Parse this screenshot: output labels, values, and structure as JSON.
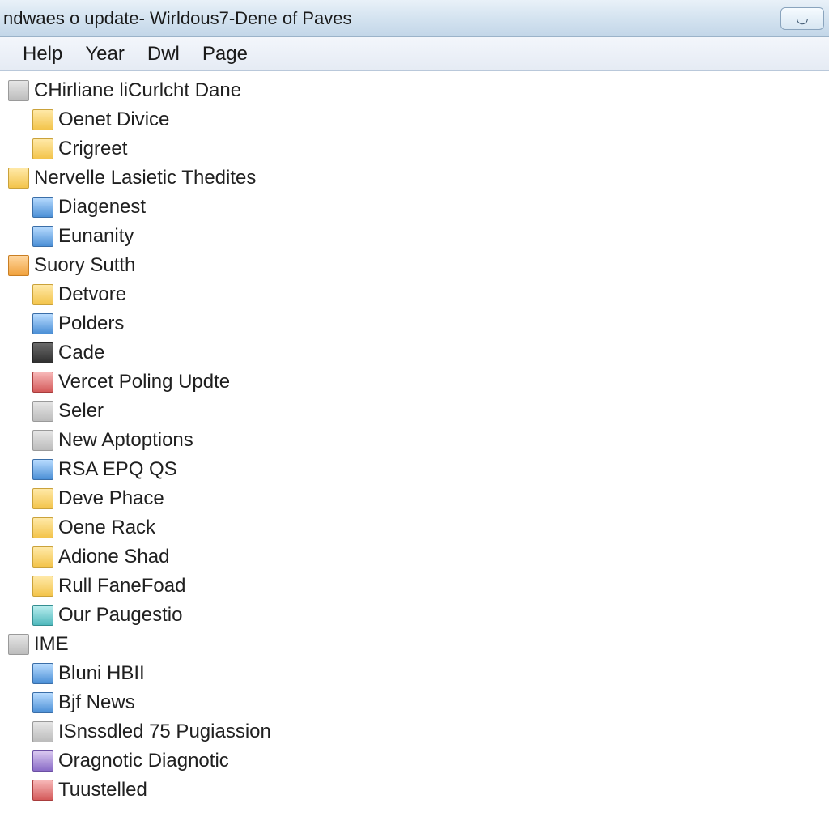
{
  "window": {
    "title": "ndwaes o update- Wirldous7-Dene of Paves",
    "minimize_glyph": "◡"
  },
  "menu": {
    "items": [
      "Help",
      "Year",
      "Dwl",
      "Page"
    ]
  },
  "list": {
    "items": [
      {
        "label": "CHirliane liCurlcht Dane",
        "icon": "ic-gray",
        "indent": false
      },
      {
        "label": "Oenet Divice",
        "icon": "ic-folder",
        "indent": true
      },
      {
        "label": "Crigreet",
        "icon": "ic-folder",
        "indent": true
      },
      {
        "label": "Nervelle Lasietic Thedites",
        "icon": "ic-folder",
        "indent": false
      },
      {
        "label": "Diagenest",
        "icon": "ic-blue",
        "indent": true
      },
      {
        "label": "Eunanity",
        "icon": "ic-blue",
        "indent": true
      },
      {
        "label": "Suory Sutth",
        "icon": "ic-orange",
        "indent": false
      },
      {
        "label": "Detvore",
        "icon": "ic-folder",
        "indent": true
      },
      {
        "label": "Polders",
        "icon": "ic-blue",
        "indent": true
      },
      {
        "label": "Cade",
        "icon": "ic-dark",
        "indent": true
      },
      {
        "label": "Vercet Poling Updte",
        "icon": "ic-red",
        "indent": true
      },
      {
        "label": "Seler",
        "icon": "ic-gray",
        "indent": true
      },
      {
        "label": "New Aptoptions",
        "icon": "ic-gray",
        "indent": true
      },
      {
        "label": "RSA EPQ QS",
        "icon": "ic-blue",
        "indent": true
      },
      {
        "label": "Deve Phace",
        "icon": "ic-folder",
        "indent": true
      },
      {
        "label": "Oene Rack",
        "icon": "ic-folder",
        "indent": true
      },
      {
        "label": "Adione Shad",
        "icon": "ic-folder",
        "indent": true
      },
      {
        "label": "Rull FaneFoad",
        "icon": "ic-folder",
        "indent": true
      },
      {
        "label": "Our Paugestio",
        "icon": "ic-teal",
        "indent": true
      },
      {
        "label": "IME",
        "icon": "ic-gray",
        "indent": false
      },
      {
        "label": "Bluni HBII",
        "icon": "ic-blue",
        "indent": true
      },
      {
        "label": "Bjf News",
        "icon": "ic-blue",
        "indent": true
      },
      {
        "label": "ISnssdled 75 Pugiassion",
        "icon": "ic-gray",
        "indent": true
      },
      {
        "label": "Oragnotic Diagnotic",
        "icon": "ic-purple",
        "indent": true
      },
      {
        "label": "Tuustelled",
        "icon": "ic-red",
        "indent": true
      }
    ]
  }
}
